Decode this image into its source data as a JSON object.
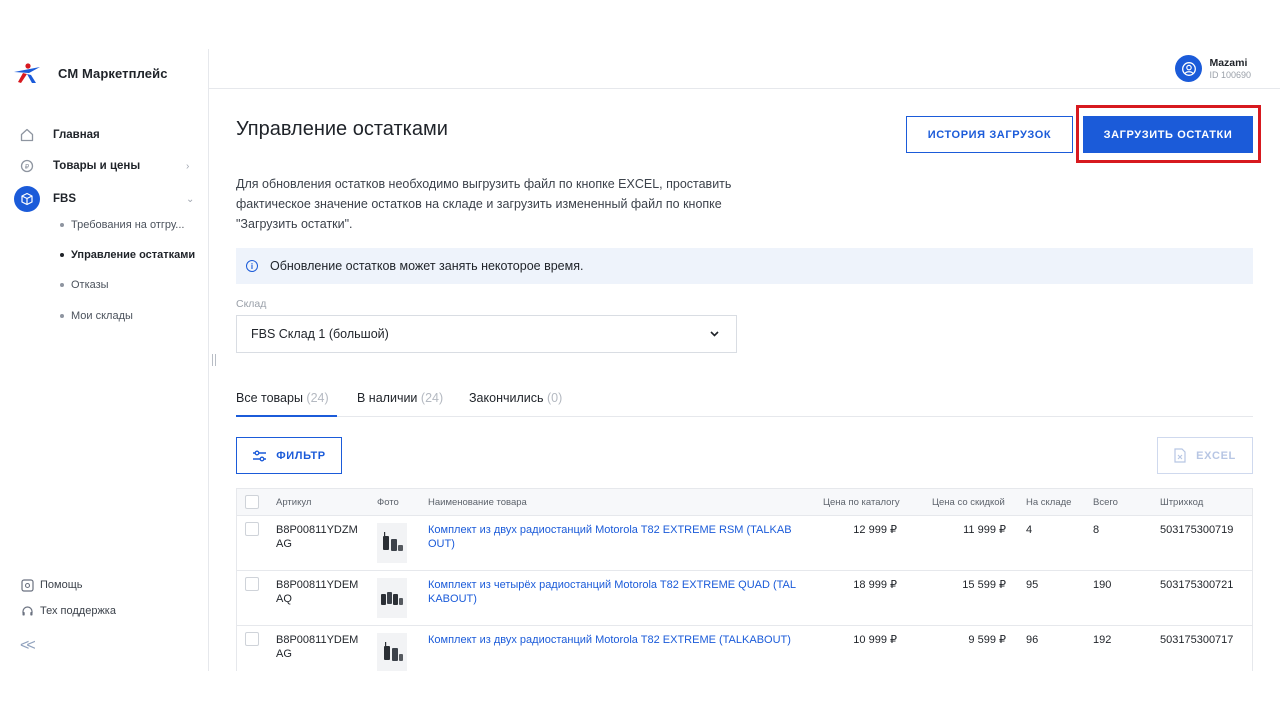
{
  "app": {
    "name": "СМ Маркетплейс"
  },
  "sidebar": {
    "items": [
      {
        "label": "Главная",
        "icon": "home-icon"
      },
      {
        "label": "Товары и цены",
        "icon": "tag-icon"
      },
      {
        "label": "FBS",
        "icon": "box-icon"
      }
    ],
    "fbs_sub": [
      {
        "label": "Требования на отгру..."
      },
      {
        "label": "Управление остатками"
      },
      {
        "label": "Отказы"
      },
      {
        "label": "Мои склады"
      }
    ],
    "footer": [
      {
        "label": "Помощь",
        "icon": "help-icon"
      },
      {
        "label": "Тех поддержка",
        "icon": "headset-icon"
      }
    ],
    "collapse_glyph": "<<"
  },
  "user": {
    "name": "Mazami",
    "id": "ID 100690"
  },
  "main": {
    "title": "Управление остатками",
    "history_button": "ИСТОРИЯ ЗАГРУЗОК",
    "upload_button": "ЗАГРУЗИТЬ ОСТАТКИ",
    "description_lines": [
      "Для обновления остатков необходимо выгрузить файл по кнопке EXCEL, проставить",
      "фактическое значение остатков на складе и загрузить измененный файл по кнопке",
      "\"Загрузить остатки\"."
    ],
    "info_text": "Обновление остатков может занять некоторое время.",
    "warehouse_label": "Склад",
    "warehouse_value": "FBS Склад 1 (большой)",
    "tabs": [
      {
        "label": "Все товары",
        "count": "(24)"
      },
      {
        "label": "В наличии",
        "count": "(24)"
      },
      {
        "label": "Закончились",
        "count": "(0)"
      }
    ],
    "filter_button": "ФИЛЬТР",
    "excel_button": "EXCEL"
  },
  "table": {
    "columns": [
      "Артикул",
      "Фото",
      "Наименование товара",
      "Цена по каталогу",
      "Цена со скидкой",
      "На складе",
      "Всего",
      "Штрихкод"
    ],
    "rows": [
      {
        "sku": "B8P00811YDZMAG",
        "name": "Комплект из двух радиостанций Motorola T82 EXTREME RSM (TALKABOUT)",
        "catalog_price": "12 999 ₽",
        "discount_price": "11 999 ₽",
        "stock": "4",
        "total": "8",
        "barcode": "503175300719"
      },
      {
        "sku": "B8P00811YDEMAQ",
        "name": "Комплект из четырёх радиостанций Motorola T82 EXTREME QUAD (TALKABOUT)",
        "catalog_price": "18 999 ₽",
        "discount_price": "15 599 ₽",
        "stock": "95",
        "total": "190",
        "barcode": "503175300721"
      },
      {
        "sku": "B8P00811YDEMAG",
        "name": "Комплект из двух радиостанций Motorola T82 EXTREME (TALKABOUT)",
        "catalog_price": "10 999 ₽",
        "discount_price": "9 599 ₽",
        "stock": "96",
        "total": "192",
        "barcode": "503175300717"
      }
    ]
  },
  "colors": {
    "accent": "#1b5bd9",
    "highlight": "#d7191f",
    "info_bg": "#eef3fb"
  }
}
